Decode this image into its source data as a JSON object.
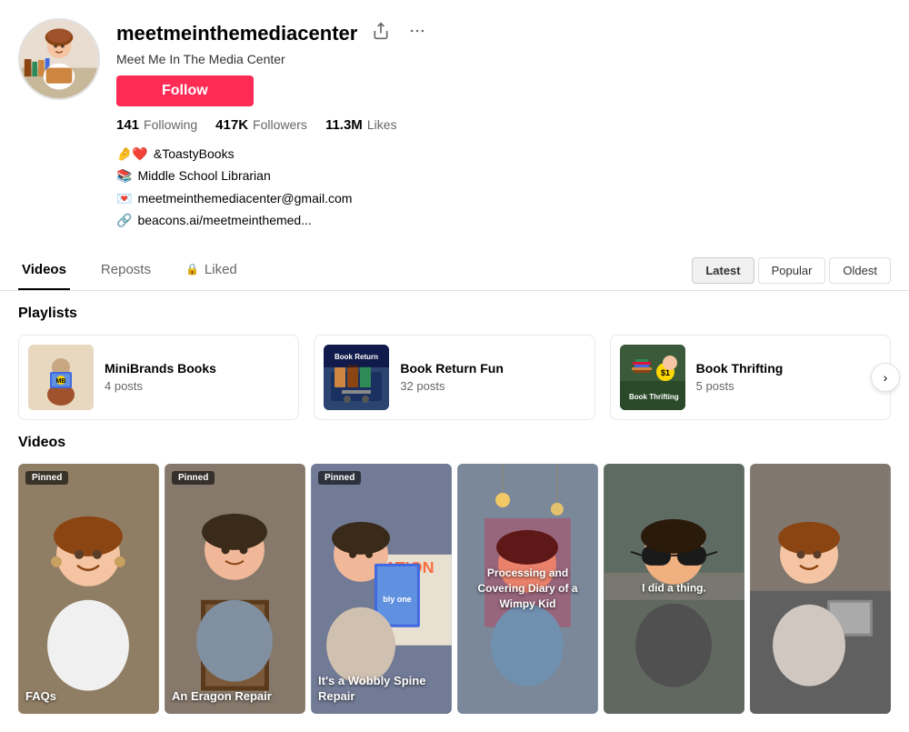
{
  "profile": {
    "username": "meetmeinthemediacenter",
    "display_name": "Meet Me In The Media Center",
    "follow_label": "Follow",
    "stats": {
      "following_count": "141",
      "following_label": "Following",
      "followers_count": "417K",
      "followers_label": "Followers",
      "likes_count": "11.3M",
      "likes_label": "Likes"
    },
    "bio": [
      "🤌❤️&ToastyBooks",
      "📚 Middle School Librarian",
      "💌 meetmeinthemediacenter@gmail.com",
      "🔗 beacons.ai/meetmeinthemed..."
    ]
  },
  "tabs": {
    "items": [
      {
        "label": "Videos",
        "active": true,
        "locked": false
      },
      {
        "label": "Reposts",
        "active": false,
        "locked": false
      },
      {
        "label": "Liked",
        "active": false,
        "locked": true
      }
    ],
    "sort_options": [
      {
        "label": "Latest",
        "active": true
      },
      {
        "label": "Popular",
        "active": false
      },
      {
        "label": "Oldest",
        "active": false
      }
    ]
  },
  "playlists_section": {
    "title": "Playlists",
    "items": [
      {
        "name": "MiniBrands Books",
        "posts": "4 posts"
      },
      {
        "name": "Book Return Fun",
        "posts": "32 posts"
      },
      {
        "name": "Book Thrifting",
        "posts": "5 posts"
      }
    ]
  },
  "videos_section": {
    "title": "Videos",
    "items": [
      {
        "pinned": true,
        "overlay_text": "FAQs",
        "overlay_position": "bottom"
      },
      {
        "pinned": true,
        "overlay_text": "An Eragon Repair",
        "overlay_position": "bottom"
      },
      {
        "pinned": true,
        "overlay_text": "It's a Wobbly Spine Repair",
        "overlay_position": "bottom"
      },
      {
        "pinned": false,
        "overlay_text": "Processing and Covering Diary of a Wimpy Kid",
        "overlay_position": "center"
      },
      {
        "pinned": false,
        "overlay_text": "I did a thing.",
        "overlay_position": "center"
      },
      {
        "pinned": false,
        "overlay_text": "",
        "overlay_position": "none"
      }
    ]
  },
  "icons": {
    "share": "⬆",
    "more": "•••",
    "lock": "🔒",
    "link": "🔗",
    "chevron_right": "›"
  }
}
